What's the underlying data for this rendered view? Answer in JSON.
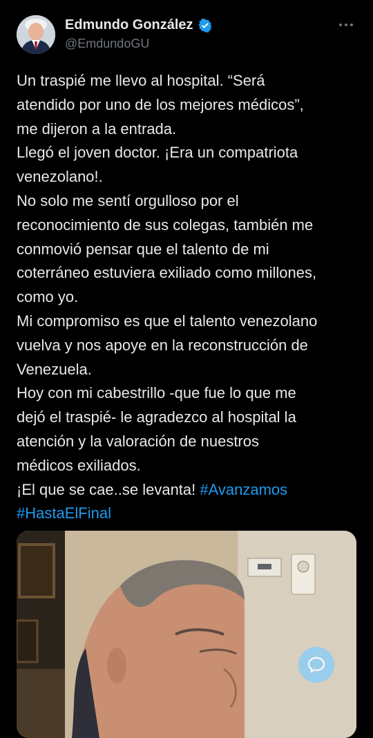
{
  "author": {
    "name": "Edmundo González",
    "handle": "@EmdundoGU",
    "avatar_icon": "profile-photo",
    "verified_icon": "verified-badge-icon",
    "verified_color": "#1d9bf0"
  },
  "header": {
    "more_icon": "more-horizontal-icon"
  },
  "tweet": {
    "lines": [
      "Un traspié me llevo al hospital. “Será",
      "atendido por uno de los mejores médicos”,",
      "me dijeron a la entrada.",
      "Llegó el joven doctor. ¡Era un compatriota",
      "venezolano!.",
      "No solo me sentí orgulloso por el",
      "reconocimiento de sus colegas, también me",
      "conmovió pensar que el talento de mi",
      "coterráneo estuviera exiliado como millones,",
      "como yo.",
      "Mi compromiso es que el talento venezolano",
      "vuelva y nos apoye en la reconstrucción de",
      "Venezuela.",
      "Hoy con mi cabestrillo -que fue lo que me",
      "dejó el traspié- le agradezco al hospital la",
      "atención y la valoración de nuestros",
      "médicos exiliados."
    ],
    "last_line_text": "¡El que se cae..se levanta! ",
    "hashtag_1": "#Avanzamos",
    "hashtag_2": "#HastaElFinal",
    "hashtag_color": "#1d9bf0"
  },
  "media": {
    "description_icon": "tweet-photo"
  },
  "fab": {
    "icon": "compose-reply-icon",
    "color": "#8ecdf5"
  }
}
